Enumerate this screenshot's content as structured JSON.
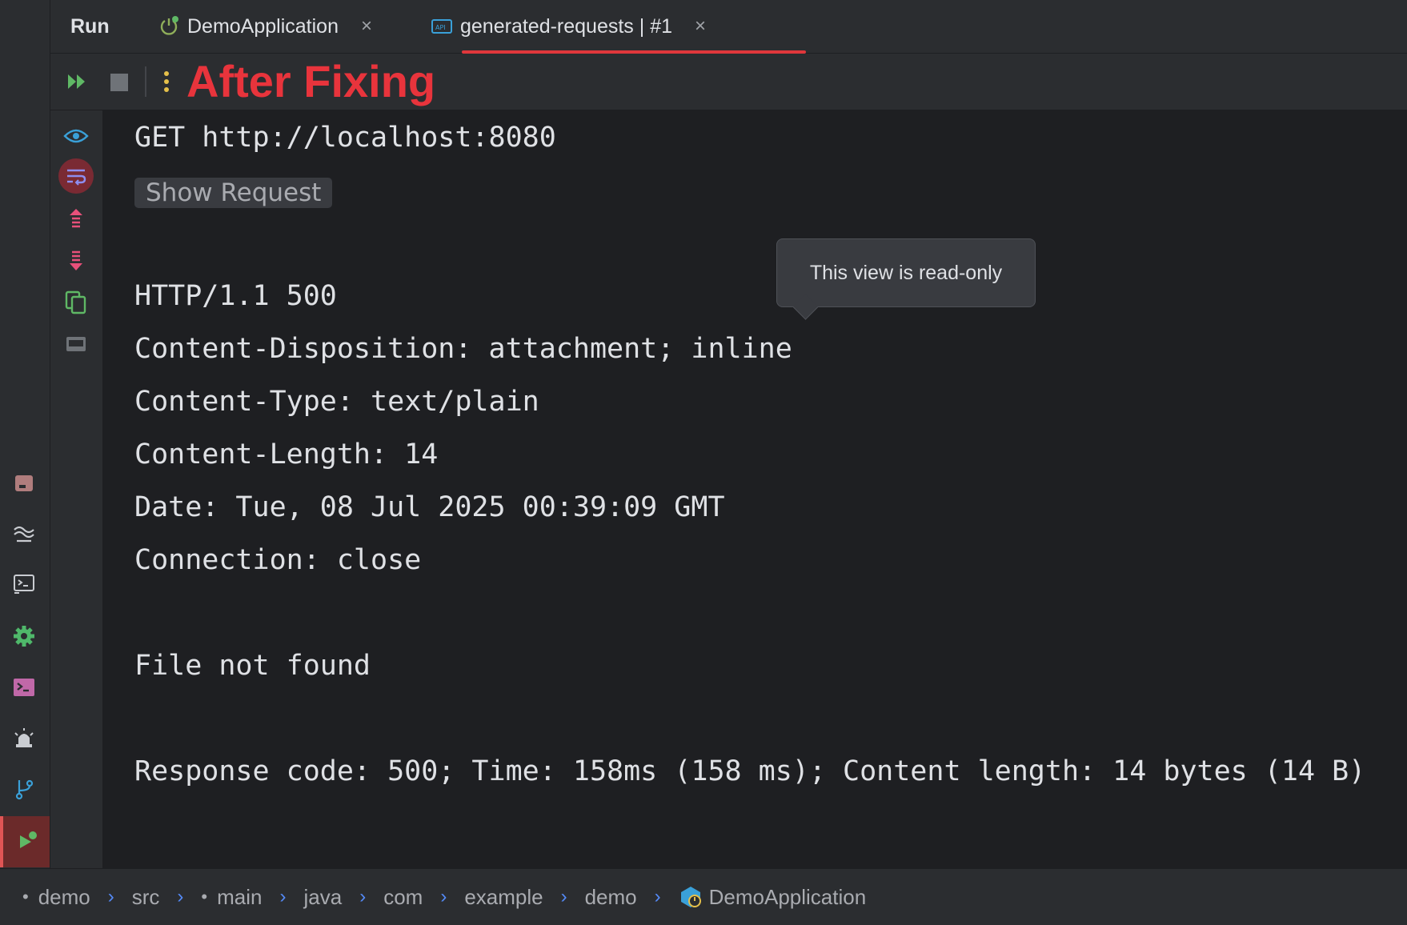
{
  "tabs": {
    "run_label": "Run",
    "items": [
      {
        "label": "DemoApplication",
        "close": "×"
      },
      {
        "label": "generated-requests | #1",
        "close": "×"
      }
    ]
  },
  "toolbar": {
    "annotation": "After Fixing",
    "annotation_color": "#e8343c"
  },
  "console": {
    "request_line": "GET http://localhost:8080",
    "show_request_label": "Show Request",
    "status_line": "HTTP/1.1 500",
    "headers": [
      "Content-Disposition: attachment; inline",
      "Content-Type: text/plain",
      "Content-Length: 14",
      "Date: Tue, 08 Jul 2025 00:39:09 GMT",
      "Connection: close"
    ],
    "body": "File not found",
    "summary": "Response code: 500; Time: 158ms (158 ms); Content length: 14 bytes (14 B)"
  },
  "tooltip": {
    "text": "This view is read-only"
  },
  "breadcrumb": [
    "demo",
    "src",
    "main",
    "java",
    "com",
    "example",
    "demo",
    "DemoApplication"
  ],
  "colors": {
    "accent_red": "#e0373b",
    "link_blue": "#548af7",
    "run_green": "#5fb865"
  }
}
